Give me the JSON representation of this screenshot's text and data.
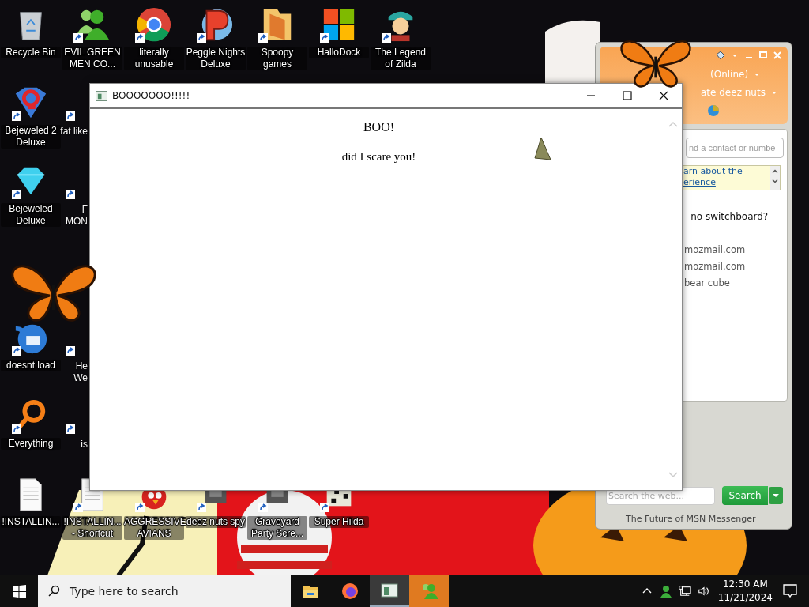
{
  "desktop_icons": [
    {
      "label": "Recycle Bin",
      "kind": "recycle-bin",
      "shortcut": false
    },
    {
      "label": "EVIL GREEN MEN CO...",
      "kind": "people",
      "shortcut": true
    },
    {
      "label": "literally unusable",
      "kind": "browser",
      "shortcut": true
    },
    {
      "label": "Peggle Nights Deluxe",
      "kind": "peggle",
      "shortcut": true
    },
    {
      "label": "Spoopy games",
      "kind": "folder",
      "shortcut": true
    },
    {
      "label": "HalloDock",
      "kind": "windows-logo",
      "shortcut": true
    },
    {
      "label": "The Legend of Zilda",
      "kind": "character",
      "shortcut": true
    },
    {
      "label": "Bejeweled 2 Deluxe",
      "kind": "gem-red",
      "shortcut": true
    },
    {
      "lines": [
        "fat like"
      ],
      "kind": "partial",
      "shortcut": true
    },
    {
      "label": "Bejeweled Deluxe",
      "kind": "gem",
      "shortcut": true
    },
    {
      "lines": [
        "F",
        "MON"
      ],
      "kind": "partial",
      "shortcut": true
    },
    {
      "label": "doesnt load",
      "kind": "bird",
      "shortcut": true
    },
    {
      "lines": [
        "He",
        "We"
      ],
      "kind": "partial",
      "shortcut": true
    },
    {
      "label": "Everything",
      "kind": "ring",
      "shortcut": true
    },
    {
      "lines": [
        "is"
      ],
      "kind": "partial",
      "shortcut": true
    },
    {
      "label": "!INSTALLIN...",
      "kind": "document",
      "shortcut": false
    },
    {
      "label": "!INSTALLIN... - Shortcut",
      "kind": "document",
      "shortcut": true
    },
    {
      "label": "AGGRESSIVE AVIANS",
      "kind": "angry-bird",
      "shortcut": true
    },
    {
      "label": "deez nuts spy",
      "kind": "block",
      "shortcut": true
    },
    {
      "label": "Graveyard Party Scre...",
      "kind": "block",
      "shortcut": true
    },
    {
      "label": "Super Hilda",
      "kind": "pixel",
      "shortcut": true
    }
  ],
  "window": {
    "title": "BOOOOOOO!!!!!",
    "heading": "BOO!",
    "message": "did I scare you!"
  },
  "messenger": {
    "status": "(Online)",
    "personal_message": "ate deez nuts",
    "contact_search": {
      "placeholder": "nd a contact or numbe"
    },
    "notice_links": [
      "arn about the",
      "erience"
    ],
    "group": "- no switchboard?",
    "contacts": [
      "mozmail.com",
      "mozmail.com",
      "bear cube"
    ],
    "web_search": {
      "placeholder": "Search the web...",
      "button": "Search"
    },
    "footer": "The Future of MSN Messenger"
  },
  "taskbar": {
    "search_placeholder": "Type here to search",
    "apps": [
      {
        "kind": "file-explorer",
        "active": false,
        "flashing": false
      },
      {
        "kind": "firefox",
        "active": false,
        "flashing": false
      },
      {
        "kind": "window",
        "active": true,
        "flashing": false
      },
      {
        "kind": "messenger",
        "active": false,
        "flashing": true
      }
    ],
    "clock": {
      "time": "12:30 AM",
      "date": "11/21/2024"
    }
  }
}
